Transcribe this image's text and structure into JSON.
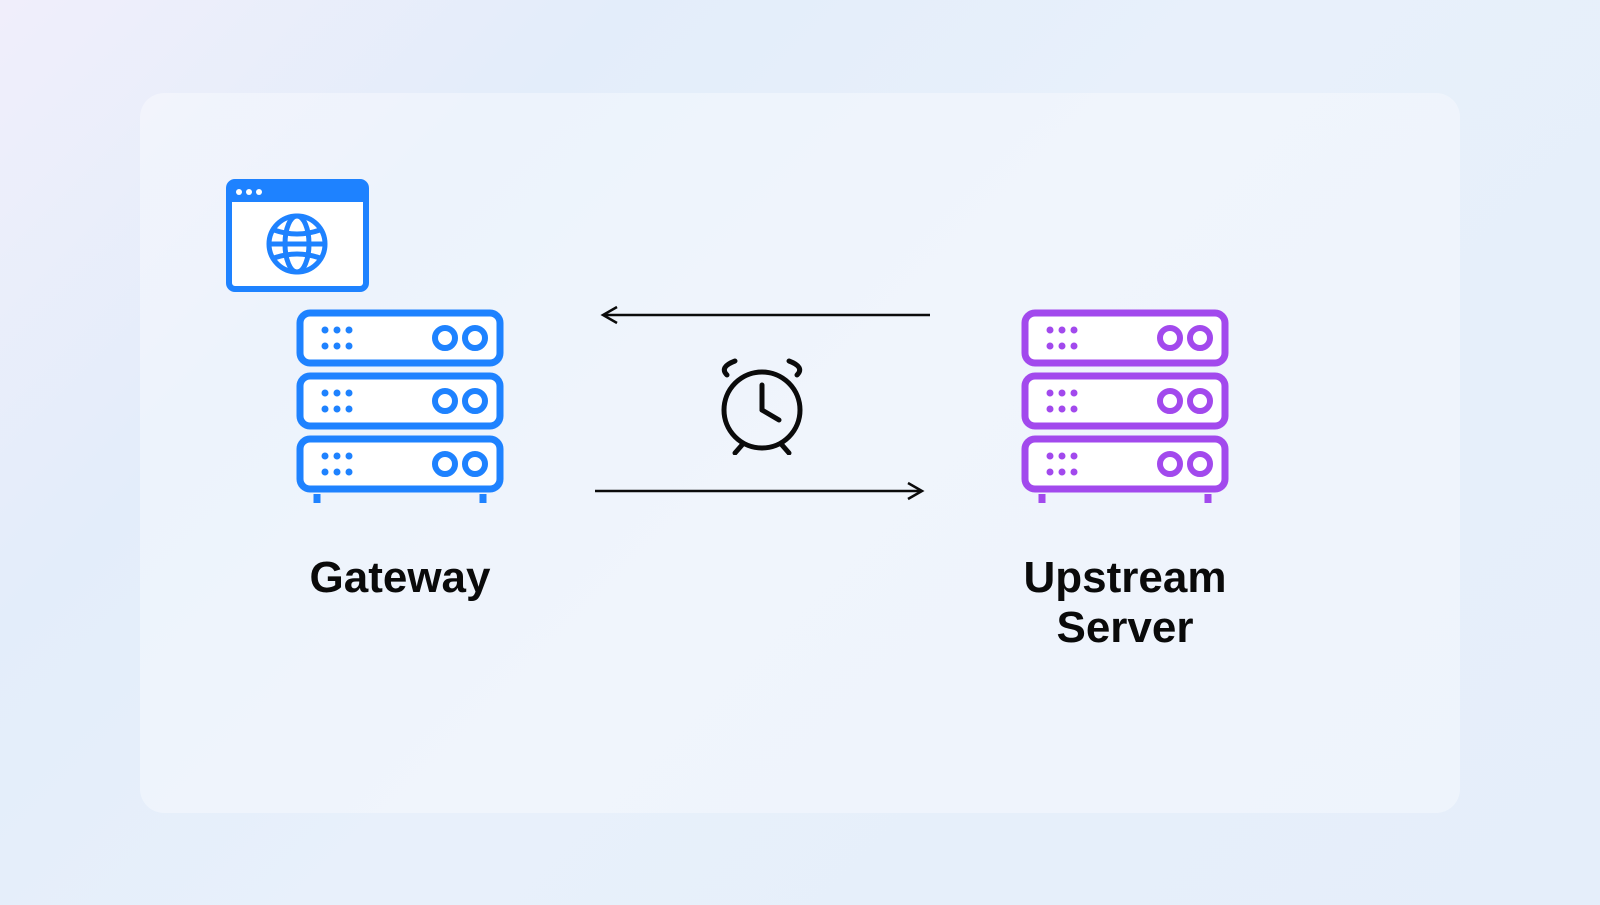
{
  "diagram": {
    "left_label": "Gateway",
    "right_label": "Upstream\nServer"
  },
  "colors": {
    "gateway_blue": "#1e82ff",
    "upstream_purple": "#a249ed",
    "outline_black": "#0b0b0b"
  }
}
